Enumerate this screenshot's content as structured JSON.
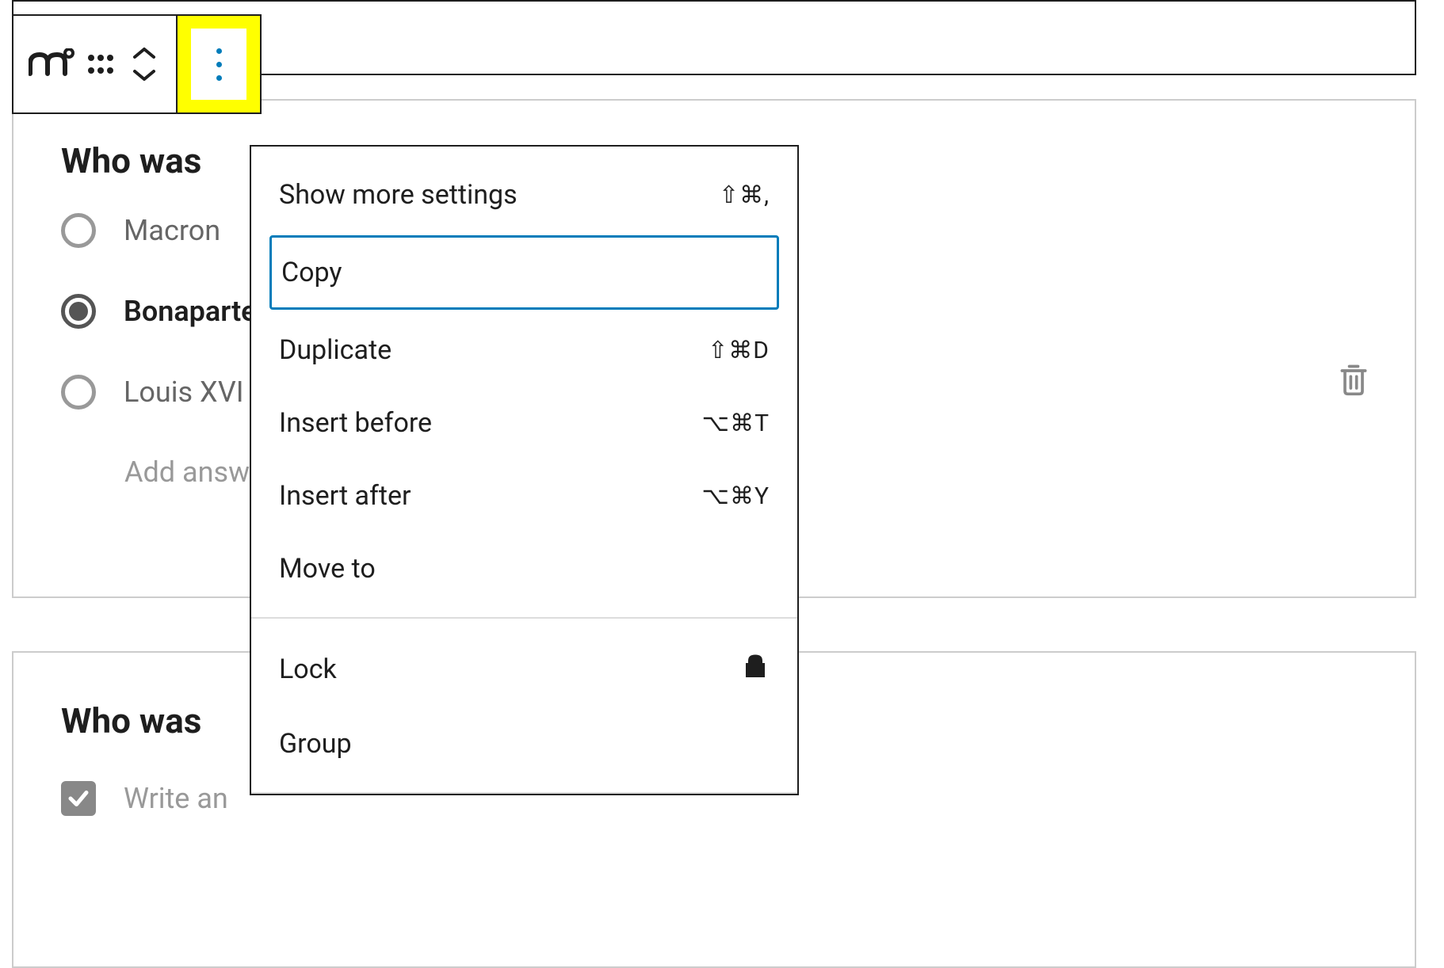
{
  "block1": {
    "title": "Who was",
    "answers": [
      {
        "label": "Macron",
        "selected": false
      },
      {
        "label": "Bonaparte",
        "selected": true
      },
      {
        "label": "Louis XVI",
        "selected": false
      }
    ],
    "add_answer_placeholder": "Add answer"
  },
  "block2": {
    "title": "Who was",
    "checkbox_label": "Write an"
  },
  "dropdown": {
    "items_section1": [
      {
        "label": "Show more settings",
        "shortcut": "⇧⌘,"
      },
      {
        "label": "Copy",
        "shortcut": "",
        "highlighted": true
      },
      {
        "label": "Duplicate",
        "shortcut": "⇧⌘D"
      },
      {
        "label": "Insert before",
        "shortcut": "⌥⌘T"
      },
      {
        "label": "Insert after",
        "shortcut": "⌥⌘Y"
      },
      {
        "label": "Move to",
        "shortcut": ""
      }
    ],
    "items_section2": [
      {
        "label": "Lock",
        "icon": "lock"
      },
      {
        "label": "Group"
      }
    ]
  }
}
